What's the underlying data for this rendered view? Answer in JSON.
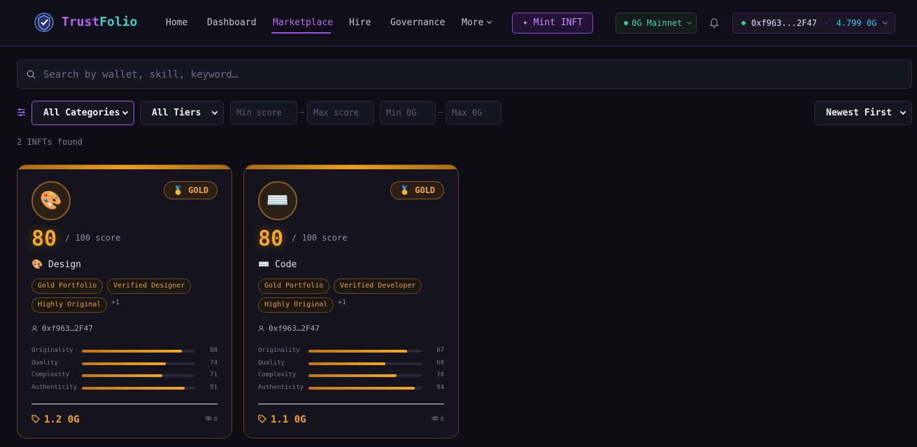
{
  "nav": {
    "brand_part1": "Trust",
    "brand_part2": "Folio",
    "links": [
      "Home",
      "Dashboard",
      "Marketplace",
      "Hire",
      "Governance",
      "More"
    ],
    "active_link": "Marketplace",
    "mint_label": "✦ Mint INFT",
    "network_label": "0G Mainnet",
    "wallet_address": "0xf963...2F47",
    "wallet_separator": "·",
    "wallet_balance": "4.799 0G"
  },
  "colors": {
    "accent_purple": "#9c53e6",
    "accent_teal": "#3fd0c4",
    "gold": "#f5a623",
    "network_green": "#2fd08a"
  },
  "search": {
    "placeholder": "Search by wallet, skill, keyword…"
  },
  "filters": {
    "category": "All Categories",
    "tier": "All Tiers",
    "min_score_placeholder": "Min score",
    "max_score_placeholder": "Max score",
    "min_og_placeholder": "Min 0G",
    "max_og_placeholder": "Max 0G",
    "range_dash": "–",
    "sort": "Newest First"
  },
  "results": {
    "count_text": "2 INFTs found"
  },
  "cards": [
    {
      "emoji": "🎨",
      "tier_label": "🥇 GOLD",
      "score": "80",
      "score_suffix": "/ 100 score",
      "category": "🎨 Design",
      "tags": [
        "Gold Portfolio",
        "Verified Designer",
        "Highly Original"
      ],
      "more_tags": "+1",
      "owner": "0xf963…2F47",
      "metrics": [
        {
          "label": "Originality",
          "value": 88
        },
        {
          "label": "Quality",
          "value": 74
        },
        {
          "label": "Complexity",
          "value": 71
        },
        {
          "label": "Authenticity",
          "value": 91
        }
      ],
      "price": "1.2 0G",
      "views": "0"
    },
    {
      "emoji": "⌨️",
      "tier_label": "🥇 GOLD",
      "score": "80",
      "score_suffix": "/ 100 score",
      "category": "⌨️ Code",
      "tags": [
        "Gold Portfolio",
        "Verified Developer",
        "Highly Original"
      ],
      "more_tags": "+1",
      "owner": "0xf963…2F47",
      "metrics": [
        {
          "label": "Originality",
          "value": 87
        },
        {
          "label": "Quality",
          "value": 68
        },
        {
          "label": "Complexity",
          "value": 78
        },
        {
          "label": "Authenticity",
          "value": 94
        }
      ],
      "price": "1.1 0G",
      "views": "0"
    }
  ]
}
